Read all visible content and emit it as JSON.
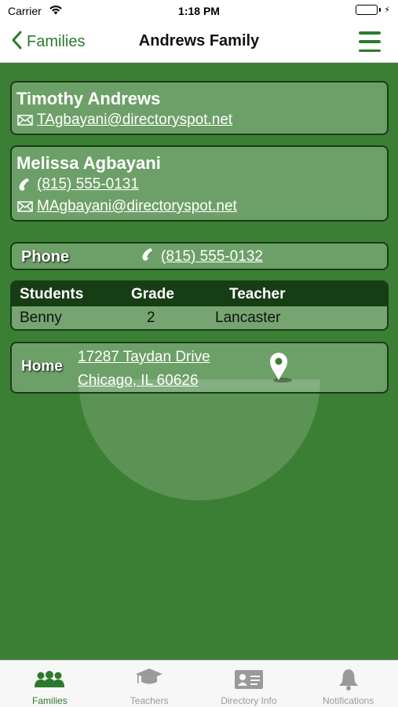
{
  "status_bar": {
    "carrier": "Carrier",
    "time": "1:18 PM"
  },
  "nav": {
    "back_label": "Families",
    "title": "Andrews Family"
  },
  "contacts": [
    {
      "name": "Timothy Andrews",
      "email": "TAgbayani@directoryspot.net"
    },
    {
      "name": "Melissa Agbayani",
      "phone": "(815) 555-0131",
      "email": "MAgbayani@directoryspot.net"
    }
  ],
  "phone_section": {
    "label": "Phone",
    "value": "(815) 555-0132"
  },
  "students": {
    "headers": [
      "Students",
      "Grade",
      "Teacher"
    ],
    "rows": [
      {
        "student": "Benny",
        "grade": "2",
        "teacher": "Lancaster"
      }
    ]
  },
  "home": {
    "label": "Home",
    "address_line1": "17287 Taydan Drive",
    "address_line2": "Chicago, IL 60626"
  },
  "tabs": [
    {
      "label": "Families",
      "icon": "families-icon",
      "active": true
    },
    {
      "label": "Teachers",
      "icon": "graduation-cap-icon",
      "active": false
    },
    {
      "label": "Directory Info",
      "icon": "id-card-icon",
      "active": false
    },
    {
      "label": "Notifications",
      "icon": "bell-icon",
      "active": false
    }
  ],
  "colors": {
    "accent": "#2d7a2d",
    "background": "#3b7f34",
    "card_border": "#173d15",
    "inactive_tab": "#999999"
  }
}
